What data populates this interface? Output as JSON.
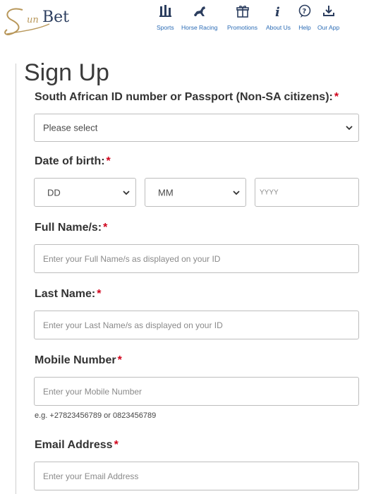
{
  "header": {
    "brand": "Bet",
    "nav": [
      {
        "label": "Sports",
        "icon": "sports-icon"
      },
      {
        "label": "Horse Racing",
        "icon": "horse-racing-icon"
      },
      {
        "label": "Promotions",
        "icon": "gift-icon"
      },
      {
        "label": "About Us",
        "icon": "info-icon"
      },
      {
        "label": "Help",
        "icon": "help-icon"
      },
      {
        "label": "Our App",
        "icon": "download-icon"
      }
    ]
  },
  "form": {
    "title": "Sign Up",
    "id_label": "South African ID number or Passport (Non-SA citizens):",
    "id_select": "Please select",
    "dob_label": "Date of birth:",
    "dob_day": "DD",
    "dob_month": "MM",
    "dob_year_placeholder": "YYYY",
    "fullname_label": "Full Name/s:",
    "fullname_placeholder": "Enter your Full Name/s as displayed on your ID",
    "lastname_label": "Last Name:",
    "lastname_placeholder": "Enter your Last Name/s as displayed on your ID",
    "mobile_label": "Mobile Number",
    "mobile_placeholder": "Enter your Mobile Number",
    "mobile_hint": "e.g. +27823456789 or 0823456789",
    "email_label": "Email Address",
    "email_placeholder": "Enter your Email Address",
    "required_mark": "*"
  },
  "colors": {
    "accent": "#2a6bb5",
    "required": "#d0021b",
    "logo_gold": "#b8975a"
  }
}
